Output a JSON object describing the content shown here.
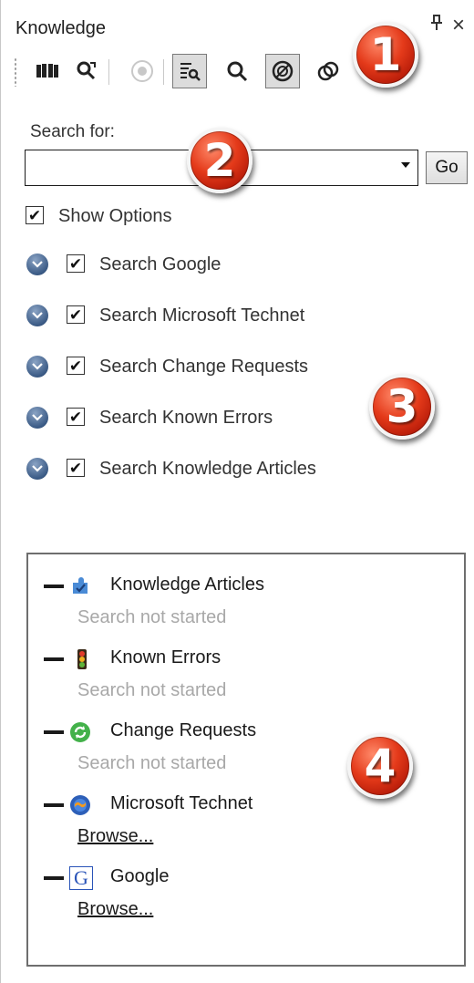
{
  "panel": {
    "title": "Knowledge",
    "pin_glyph": "⊥",
    "close_glyph": "×"
  },
  "toolbar": {
    "buttons": [
      {
        "icon": "book-icon",
        "pressed": false
      },
      {
        "icon": "search-refresh-icon",
        "pressed": false
      },
      {
        "icon": "stop-icon",
        "pressed": false
      },
      {
        "icon": "document-search-icon",
        "pressed": true
      },
      {
        "icon": "magnifier-icon",
        "pressed": false
      },
      {
        "icon": "link-circles-pressed-icon",
        "pressed": true
      },
      {
        "icon": "link-circles-icon",
        "pressed": false
      }
    ]
  },
  "search": {
    "label": "Search for:",
    "value": "",
    "go_label": "Go",
    "show_options_label": "Show Options",
    "show_options_checked": true
  },
  "options": [
    {
      "label": "Search Google",
      "checked": true
    },
    {
      "label": "Search Microsoft Technet",
      "checked": true
    },
    {
      "label": "Search Change Requests",
      "checked": true
    },
    {
      "label": "Search Known Errors",
      "checked": true
    },
    {
      "label": "Search Knowledge Articles",
      "checked": true
    }
  ],
  "results": [
    {
      "title": "Knowledge Articles",
      "status": "Search not started",
      "icon": "knowledge-articles-icon"
    },
    {
      "title": "Known Errors",
      "status": "Search not started",
      "icon": "traffic-light-icon"
    },
    {
      "title": "Change Requests",
      "status": "Search not started",
      "icon": "change-requests-icon"
    },
    {
      "title": "Microsoft Technet",
      "link": "Browse...",
      "icon": "technet-icon"
    },
    {
      "title": "Google",
      "link": "Browse...",
      "icon": "google-icon",
      "icon_letter": "G"
    }
  ],
  "badges": [
    "1",
    "2",
    "3",
    "4"
  ],
  "colors": {
    "badge_red": "#e43a1a",
    "chevron_blue": "#3b5b86",
    "status_gray": "#a8a8a8"
  }
}
